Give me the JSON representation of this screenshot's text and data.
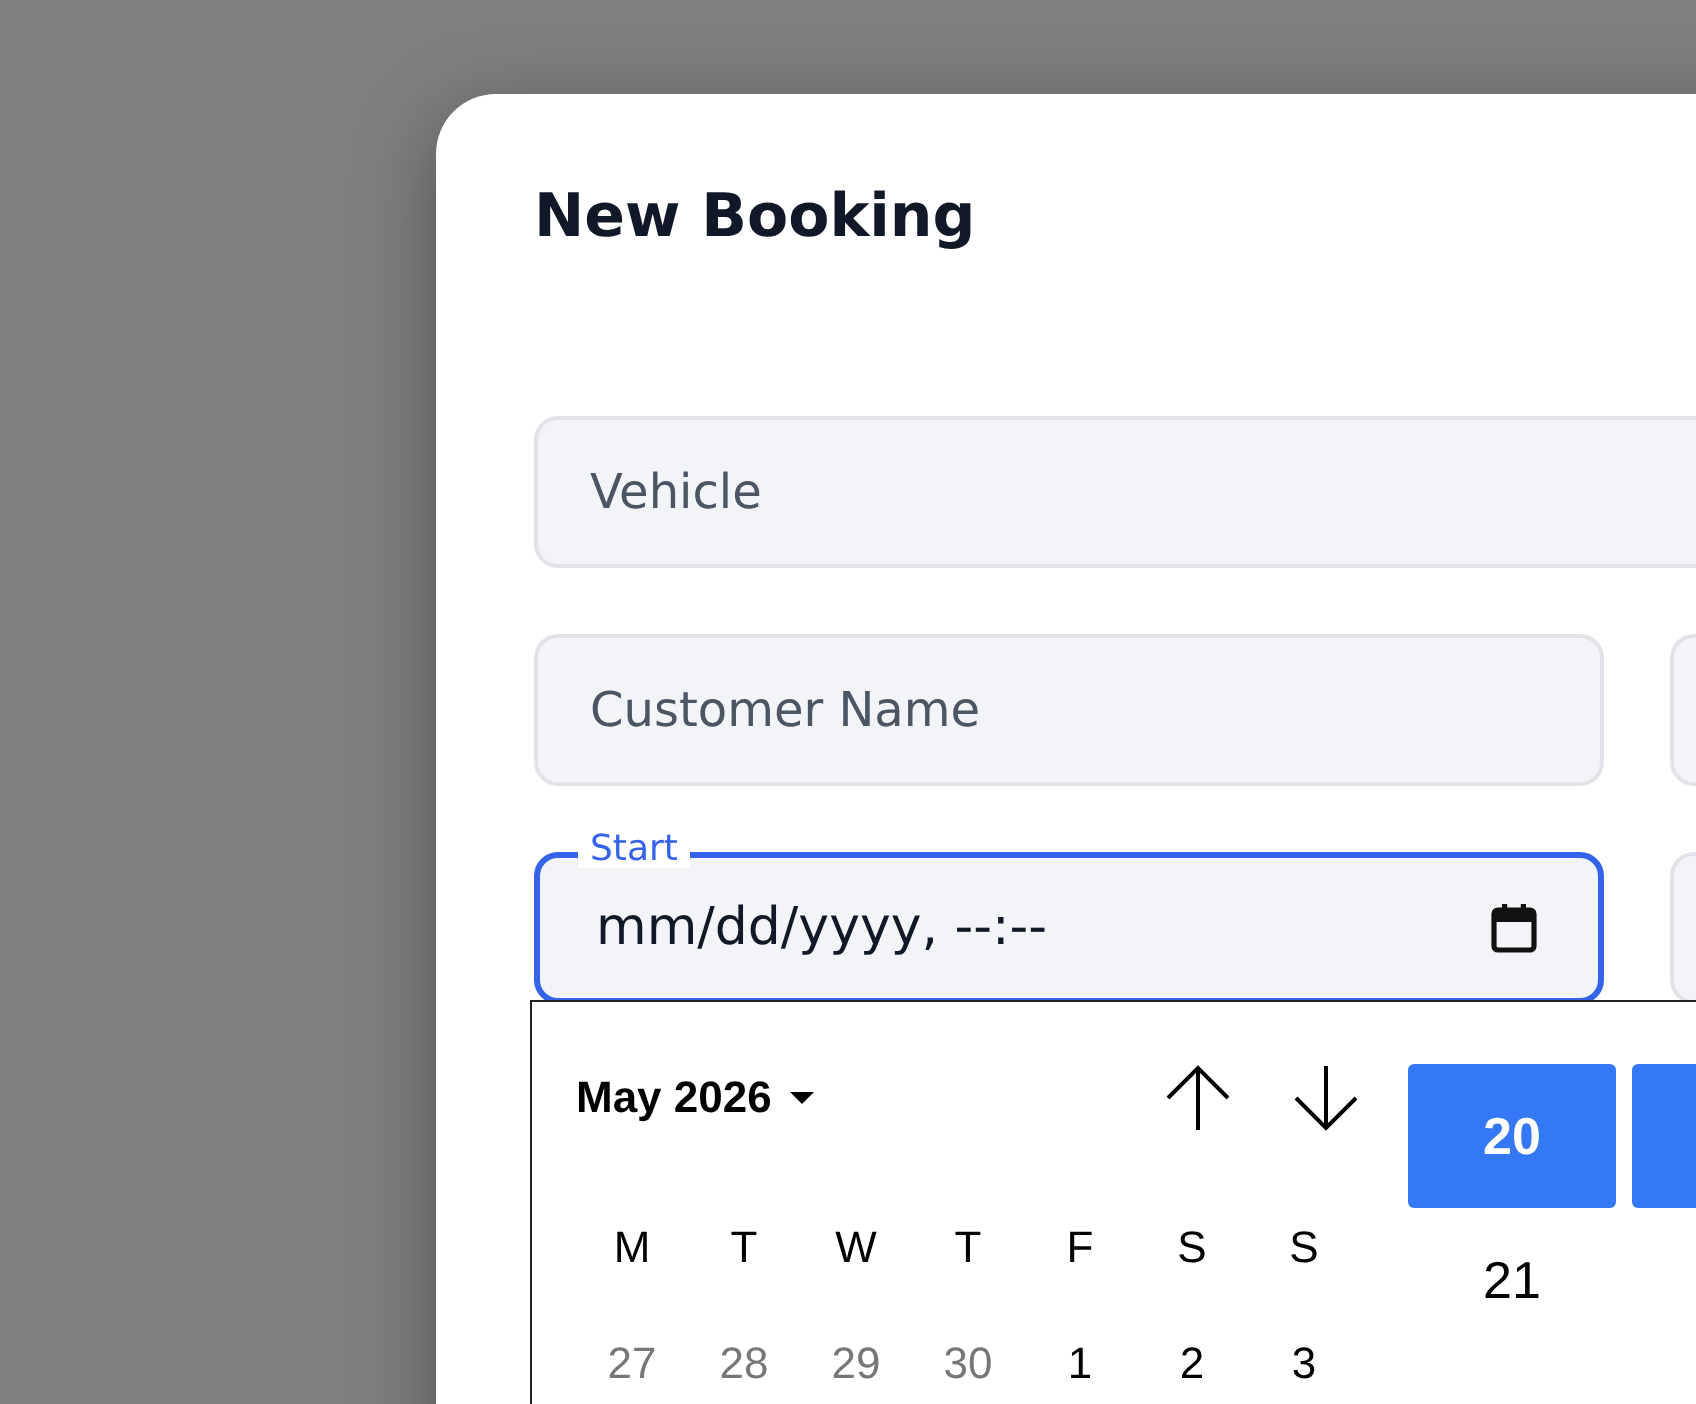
{
  "dialog": {
    "title": "New Booking"
  },
  "fields": {
    "vehicle": {
      "placeholder": "Vehicle"
    },
    "customer_name": {
      "placeholder": "Customer Name"
    },
    "start": {
      "label": "Start",
      "value": "mm/dd/yyyy, --:--",
      "focused": true
    }
  },
  "date_picker": {
    "month_label": "May 2026",
    "weekdays": [
      "M",
      "T",
      "W",
      "T",
      "F",
      "S",
      "S"
    ],
    "days": [
      {
        "label": "27",
        "outside_month": true
      },
      {
        "label": "28",
        "outside_month": true
      },
      {
        "label": "29",
        "outside_month": true
      },
      {
        "label": "30",
        "outside_month": true
      },
      {
        "label": "1",
        "outside_month": false
      },
      {
        "label": "2",
        "outside_month": false
      },
      {
        "label": "3",
        "outside_month": false
      }
    ],
    "hours": [
      {
        "label": "20",
        "selected": true
      },
      {
        "label": "21",
        "selected": false
      }
    ],
    "minutes": [
      {
        "selected": true
      }
    ]
  }
}
